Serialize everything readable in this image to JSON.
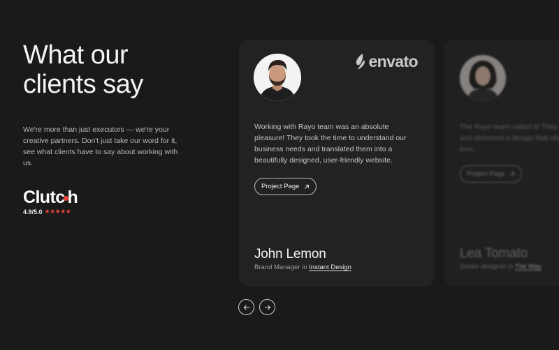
{
  "intro": {
    "title_line1": "What our",
    "title_line2": "clients say",
    "description": "We're more than just executors — we're your creative partners. Don't just take our word for it, see what clients have to say about working with us."
  },
  "clutch": {
    "logo_pre": "Clutch",
    "rating": "4.9/5.0",
    "stars": "★★★★★",
    "accent_color": "#ef4335"
  },
  "testimonials": [
    {
      "brand": "envato",
      "brand_icon": "envato-leaf-icon",
      "quote": "Working with Rayo team was an absolute pleasure! They took the time to understand our business needs and translated them into a beautifully designed, user-friendly website.",
      "button_label": "Project Page",
      "name": "John Lemon",
      "role_prefix": "Brand Manager in",
      "company": "Instant Design"
    },
    {
      "quote": "The Rayo team nailed it! They listened and delivered a design that clients love.",
      "button_label": "Project Page",
      "name": "Lea Tomato",
      "role_prefix": "Senior designer in",
      "company": "The Way"
    }
  ],
  "nav": {
    "prev_icon": "arrow-left-icon",
    "next_icon": "arrow-right-icon"
  }
}
